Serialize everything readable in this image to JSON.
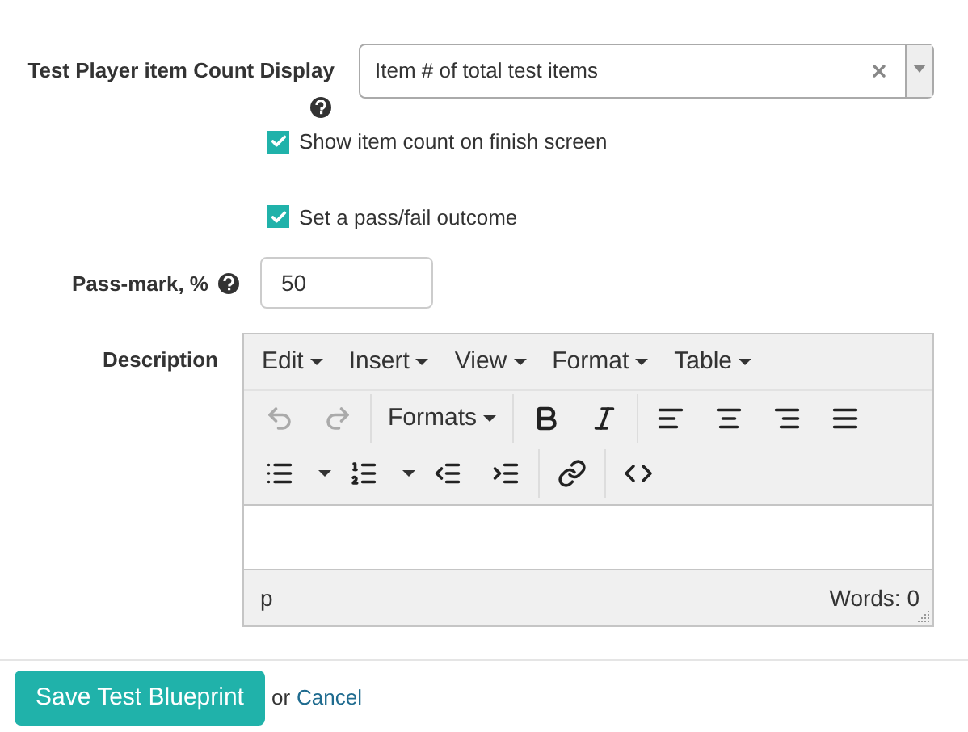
{
  "count_display": {
    "label": "Test Player item Count Display",
    "value": "Item # of total test items"
  },
  "checkboxes": [
    {
      "label": "Show item count on finish screen",
      "checked": true
    },
    {
      "label": "Set a pass/fail outcome",
      "checked": true
    }
  ],
  "pass_mark": {
    "label": "Pass-mark, %",
    "value": "50"
  },
  "description": {
    "label": "Description",
    "menus": [
      "Edit",
      "Insert",
      "View",
      "Format",
      "Table"
    ],
    "toolbar_rows": [
      [
        [
          {
            "kind": "undo",
            "disabled": true
          },
          {
            "kind": "redo",
            "disabled": true
          }
        ],
        [
          {
            "kind": "dropdown",
            "label": "Formats"
          }
        ],
        [
          {
            "kind": "bold"
          },
          {
            "kind": "italic"
          }
        ],
        [
          {
            "kind": "alignleft"
          },
          {
            "kind": "aligncenter"
          },
          {
            "kind": "alignright"
          },
          {
            "kind": "justify"
          }
        ]
      ],
      [
        [
          {
            "kind": "bullets"
          },
          {
            "kind": "caret"
          },
          {
            "kind": "numbered"
          },
          {
            "kind": "caret"
          },
          {
            "kind": "outdent"
          },
          {
            "kind": "indent"
          }
        ],
        [
          {
            "kind": "link"
          }
        ],
        [
          {
            "kind": "code"
          }
        ]
      ]
    ],
    "path": "p",
    "word_count": "Words: 0"
  },
  "save_button": "Save Test Blueprint",
  "or_text": "or",
  "cancel_link": "Cancel"
}
